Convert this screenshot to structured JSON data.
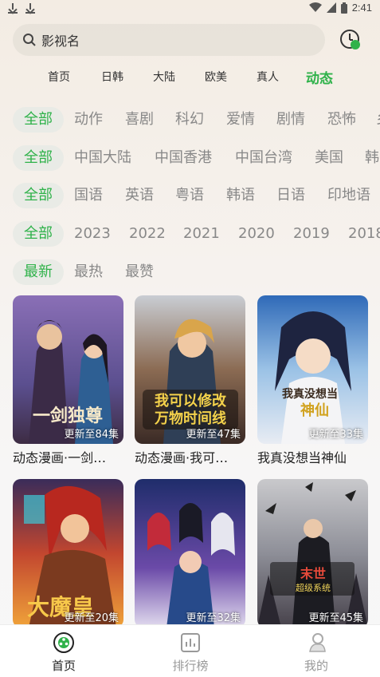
{
  "status_bar": {
    "time": "2:41",
    "icons": [
      "download-icon",
      "download-icon",
      "wifi-icon",
      "cell-signal-icon",
      "battery-icon"
    ]
  },
  "search": {
    "placeholder": "影视名",
    "icon": "search-icon"
  },
  "history_icon": "history-clock-icon",
  "nav_tabs": [
    {
      "label": "首页",
      "active": false
    },
    {
      "label": "日韩",
      "active": false
    },
    {
      "label": "大陆",
      "active": false
    },
    {
      "label": "欧美",
      "active": false
    },
    {
      "label": "真人",
      "active": false
    },
    {
      "label": "动态",
      "active": true
    }
  ],
  "filters": {
    "genre": [
      "全部",
      "动作",
      "喜剧",
      "科幻",
      "爱情",
      "剧情",
      "恐怖",
      "乡"
    ],
    "region": [
      "全部",
      "中国大陆",
      "中国香港",
      "中国台湾",
      "美国",
      "韩"
    ],
    "language": [
      "全部",
      "国语",
      "英语",
      "粤语",
      "韩语",
      "日语",
      "印地语"
    ],
    "year": [
      "全部",
      "2023",
      "2022",
      "2021",
      "2020",
      "2019",
      "2018"
    ],
    "sort": [
      "最新",
      "最热",
      "最赞"
    ]
  },
  "cards": [
    {
      "title": "动态漫画·一剑…",
      "badge": "更新至84集",
      "cover_text": "一剑独尊"
    },
    {
      "title": "动态漫画·我可…",
      "badge": "更新至47集",
      "cover_text": "我可以修改万物时间线"
    },
    {
      "title": "我真没想当神仙",
      "badge": "更新至33集",
      "cover_text": "我真没想当神仙"
    },
    {
      "title": "",
      "badge": "更新至20集",
      "cover_text": "大魔皇"
    },
    {
      "title": "",
      "badge": "更新至32集",
      "cover_text": ""
    },
    {
      "title": "",
      "badge": "更新至45集",
      "cover_text": "末世 超级系统"
    }
  ],
  "bottom_nav": [
    {
      "label": "首页",
      "icon": "home-film-icon",
      "active": true
    },
    {
      "label": "排行榜",
      "icon": "chart-icon",
      "active": false
    },
    {
      "label": "我的",
      "icon": "profile-icon",
      "active": false
    }
  ],
  "colors": {
    "accent": "#2fb24a",
    "chip_bg": "#e9ebe6",
    "inactive_text": "#888888"
  }
}
